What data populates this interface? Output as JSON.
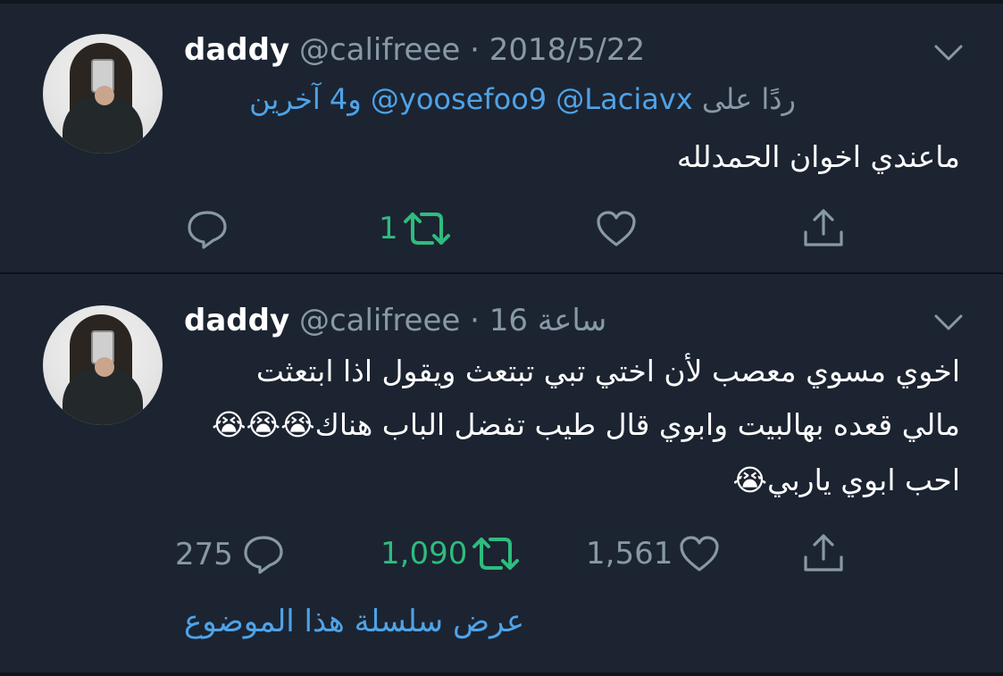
{
  "tweets": [
    {
      "name": "daddy",
      "handle": "@califreee",
      "separator": "·",
      "time": "2018/5/22",
      "reply_label": "ردًا على",
      "reply_mentions": "@yoosefoo9 @Laciavx",
      "reply_others": "و4 آخرين",
      "text_lines": [
        "ماعندي اخوان الحمدلله"
      ],
      "actions": {
        "reply_count": "",
        "retweet_count": "1",
        "like_count": ""
      }
    },
    {
      "name": "daddy",
      "handle": "@califreee",
      "separator": "·",
      "time": "16 ساعة",
      "text_lines": [
        "اخوي مسوي معصب لأن اختي تبي تبتعث ويقول اذا ابتعثت",
        "مالي قعده بهالبيت وابوي قال طيب تفضل الباب هناك😭😭😭",
        "احب ابوي ياربي😭"
      ],
      "actions": {
        "reply_count": "275",
        "retweet_count": "1,090",
        "like_count": "1,561"
      },
      "thread_link": "عرض سلسلة هذا الموضوع"
    }
  ],
  "icons": [
    "chevron-down-icon",
    "reply-icon",
    "retweet-icon",
    "like-icon",
    "share-icon"
  ],
  "colors": {
    "background": "#1c2431",
    "muted": "#8899a6",
    "link": "#4fa3e8",
    "retweet_active": "#2ebc7f"
  }
}
